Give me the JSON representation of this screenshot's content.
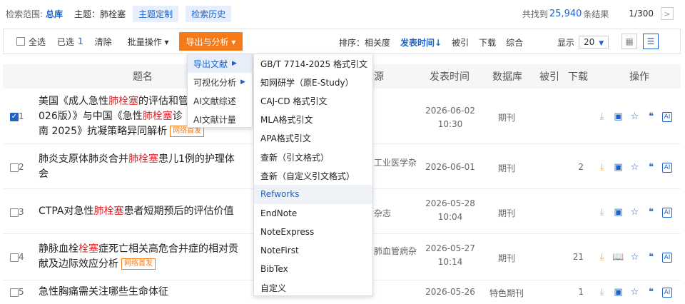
{
  "scope": {
    "label": "检索范围:",
    "db": "总库",
    "topic": "主题：肺栓塞",
    "btn_custom": "主题定制",
    "btn_history": "检索历史",
    "found_prefix": "共找到",
    "total": "25,940",
    "found_suffix": "条结果",
    "page": "1/300",
    "next": ">"
  },
  "toolbar": {
    "select_all": "全选",
    "selected_label": "已选",
    "selected_count": "1",
    "clear": "清除",
    "batch": "批量操作 ▾",
    "export": "导出与分析 ▾",
    "sort_label": "排序：相关度",
    "sort_date": "发表时间↓",
    "sort_cite": "被引",
    "sort_download": "下载",
    "sort_comprehensive": "综合",
    "show_label": "显示",
    "show_value": "20",
    "show_arrow": "▼"
  },
  "table_header": {
    "title": "题名",
    "source": "源",
    "date": "发表时间",
    "db": "数据库",
    "cite": "被引",
    "download": "下载",
    "ops": "操作"
  },
  "rows": [
    {
      "idx": "1",
      "t1": "美国《成人急性",
      "h1": "肺栓塞",
      "t2": "的评估和管",
      "t3": "026版）》与中国《急性",
      "h2": "肺栓塞",
      "t4": "诊",
      "t5": "南 2025》抗凝策略异同解析",
      "tag": "网络首发",
      "source": "",
      "date1": "2026-06-02",
      "date2": "10:30",
      "db": "期刊",
      "cite": ""
    },
    {
      "idx": "2",
      "t1": "肺炎支原体肺炎合并",
      "h1": "肺栓塞",
      "t2": "患儿1例的护理体",
      "t3": "会",
      "source": "工业医学杂",
      "date1": "2026-06-01",
      "date2": "",
      "db": "期刊",
      "cite": "2"
    },
    {
      "idx": "3",
      "t1": "CTPA对急性",
      "h1": "肺栓塞",
      "t2": "患者短期预后的评估价值",
      "source": "杂志",
      "date1": "2026-05-28",
      "date2": "10:04",
      "db": "期刊",
      "cite": ""
    },
    {
      "idx": "4",
      "t1": "静脉血栓",
      "h1": "栓塞",
      "t2": "症死亡相关高危合并症的相对贡",
      "t3": "献及边际效应分析",
      "tag": "网络首发",
      "source": "肺血管病杂",
      "date1": "2026-05-27",
      "date2": "10:14",
      "db": "期刊",
      "cite": "21"
    },
    {
      "idx": "5",
      "t1": "急性胸痛需关注哪些生命体征",
      "source": "",
      "date1": "2026-05-26",
      "date2": "",
      "db": "特色期刊",
      "cite": "1"
    }
  ],
  "menu1": {
    "items": [
      {
        "label": "导出文献"
      },
      {
        "label": "可视化分析"
      },
      {
        "label": "AI文献综述"
      },
      {
        "label": "AI文献计量"
      }
    ]
  },
  "menu2": {
    "items": [
      "GB/T 7714-2025 格式引文",
      "知网研学（原E-Study）",
      "CAJ-CD 格式引文",
      "MLA格式引文",
      "APA格式引文",
      "查新（引文格式）",
      "查新（自定义引文格式）",
      "Refworks",
      "EndNote",
      "NoteExpress",
      "NoteFirst",
      "BibTex",
      "自定义"
    ]
  },
  "icons": {
    "download": "download-icon",
    "read": "read-icon",
    "favorite": "star-icon",
    "quote": "quote-icon",
    "ai": "ai-icon"
  }
}
